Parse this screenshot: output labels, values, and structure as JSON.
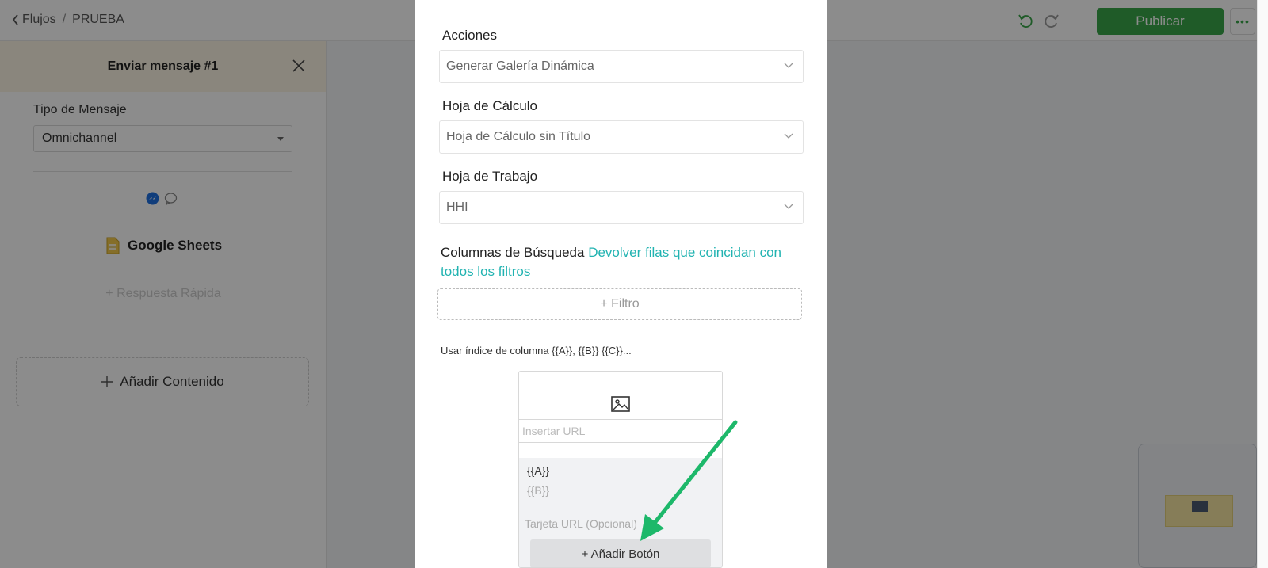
{
  "header": {
    "back_label": "Flujos",
    "separator": "/",
    "flow_name": "PRUEBA",
    "publish_label": "Publicar",
    "more_label": "•••"
  },
  "left_panel": {
    "title": "Enviar mensaje #1",
    "message_type_label": "Tipo de Mensaje",
    "message_type_value": "Omnichannel",
    "integration_label": "Google Sheets",
    "quick_reply_label": "+ Respuesta Rápida",
    "add_content_label": "Añadir Contenido"
  },
  "modal": {
    "actions_label": "Acciones",
    "actions_value": "Generar Galería Dinámica",
    "spreadsheet_label": "Hoja de Cálculo",
    "spreadsheet_value": "Hoja de Cálculo sin Título",
    "worksheet_label": "Hoja de Trabajo",
    "worksheet_value": "HHI",
    "search_columns_label": "Columnas de Búsqueda",
    "search_columns_link": "Devolver filas que coincidan con todos los filtros",
    "filter_button": "+ Filtro",
    "column_index_hint": "Usar índice de columna {{A}}, {{B}} {{C}}...",
    "card": {
      "url_placeholder": "Insertar URL",
      "title_value": "{{A}}",
      "subtitle_value": "{{B}}",
      "card_url_placeholder": "Tarjeta URL (Opcional)",
      "add_button_label": "+ Añadir Botón"
    }
  },
  "colors": {
    "publish": "#3aa64a",
    "link": "#21b3b1",
    "arrow": "#1db86a",
    "panel_header": "#fbf4e3"
  }
}
